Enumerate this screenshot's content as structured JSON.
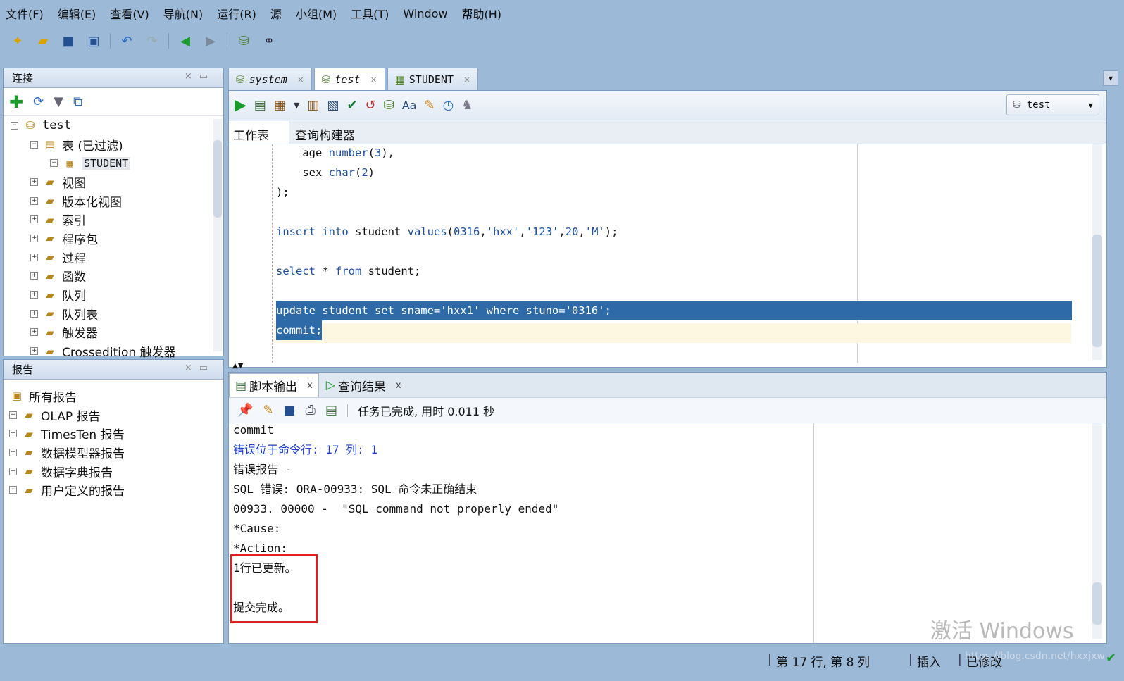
{
  "menu": [
    "文件(F)",
    "编辑(E)",
    "查看(V)",
    "导航(N)",
    "运行(R)",
    "源",
    "小组(M)",
    "工具(T)",
    "Window",
    "帮助(H)"
  ],
  "connections_panel": {
    "title": "连接",
    "tree": [
      {
        "label": "test",
        "level": 0,
        "expanded": true,
        "icon": "database-icon"
      },
      {
        "label": "表 (已过滤)",
        "level": 1,
        "expanded": true,
        "icon": "tables-folder-icon"
      },
      {
        "label": "STUDENT",
        "level": 2,
        "expanded": false,
        "icon": "table-icon"
      },
      {
        "label": "视图",
        "level": 1,
        "expanded": false,
        "icon": "view-folder-icon"
      },
      {
        "label": "版本化视图",
        "level": 1,
        "expanded": false,
        "icon": "view-folder-icon"
      },
      {
        "label": "索引",
        "level": 1,
        "expanded": false,
        "icon": "index-folder-icon"
      },
      {
        "label": "程序包",
        "level": 1,
        "expanded": false,
        "icon": "package-folder-icon"
      },
      {
        "label": "过程",
        "level": 1,
        "expanded": false,
        "icon": "procedure-folder-icon"
      },
      {
        "label": "函数",
        "level": 1,
        "expanded": false,
        "icon": "function-folder-icon"
      },
      {
        "label": "队列",
        "level": 1,
        "expanded": false,
        "icon": "queue-folder-icon"
      },
      {
        "label": "队列表",
        "level": 1,
        "expanded": false,
        "icon": "queue-table-folder-icon"
      },
      {
        "label": "触发器",
        "level": 1,
        "expanded": false,
        "icon": "trigger-folder-icon"
      },
      {
        "label": "Crossedition 触发器",
        "level": 1,
        "expanded": false,
        "icon": "trigger-folder-icon"
      }
    ]
  },
  "reports_panel": {
    "title": "报告",
    "items": [
      {
        "label": "所有报告",
        "level": 0
      },
      {
        "label": "OLAP 报告",
        "level": 1
      },
      {
        "label": "TimesTen 报告",
        "level": 1
      },
      {
        "label": "数据模型器报告",
        "level": 1
      },
      {
        "label": "数据字典报告",
        "level": 1
      },
      {
        "label": "用户定义的报告",
        "level": 1
      }
    ]
  },
  "editor_tabs": [
    {
      "label": "system",
      "active": false
    },
    {
      "label": "test",
      "active": true
    },
    {
      "label": "STUDENT",
      "active": false
    }
  ],
  "connection_selector": "test",
  "subtabs": [
    "工作表",
    "查询构建器"
  ],
  "code_lines": [
    "    age number(3),",
    "    sex char(2)",
    ");",
    "",
    "insert into student values(0316,'hxx','123',20,'M');",
    "",
    "select * from student;",
    "",
    "update student set sname='hxx1' where stuno='0316';",
    "commit;"
  ],
  "output_tabs": [
    "脚本输出",
    "查询结果"
  ],
  "output_status": "任务已完成, 用时 0.011 秒",
  "output_lines": [
    "commit",
    "错误位于命令行: 17 列: 1",
    "错误报告 -",
    "SQL 错误: ORA-00933: SQL 命令未正确结束",
    "00933. 00000 -  \"SQL command not properly ended\"",
    "*Cause:",
    "*Action:",
    "1行已更新。",
    "",
    "提交完成。"
  ],
  "watermark": "激活 Windows",
  "status_bar": {
    "position": "第 17 行, 第 8 列",
    "mode": "插入",
    "modified": "已修改",
    "url": "https://blog.csdn.net/hxxjxw"
  },
  "colors": {
    "selection": "#2f6aa8",
    "keyword": "#1c4fa0",
    "error_link": "#1f3fcf",
    "highlight_box": "#e02020"
  }
}
